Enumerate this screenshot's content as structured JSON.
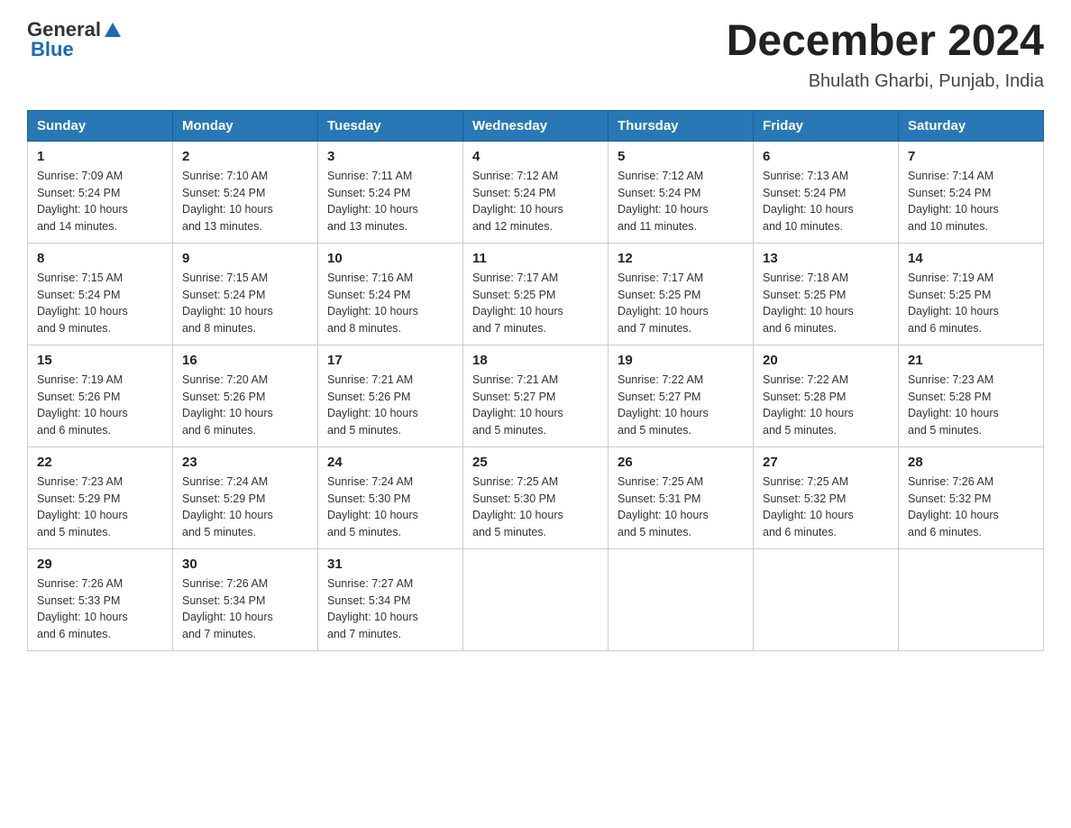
{
  "header": {
    "logo_general": "General",
    "logo_blue": "Blue",
    "title": "December 2024",
    "subtitle": "Bhulath Gharbi, Punjab, India"
  },
  "weekdays": [
    "Sunday",
    "Monday",
    "Tuesday",
    "Wednesday",
    "Thursday",
    "Friday",
    "Saturday"
  ],
  "weeks": [
    [
      {
        "day": "1",
        "sunrise": "7:09 AM",
        "sunset": "5:24 PM",
        "daylight": "10 hours and 14 minutes."
      },
      {
        "day": "2",
        "sunrise": "7:10 AM",
        "sunset": "5:24 PM",
        "daylight": "10 hours and 13 minutes."
      },
      {
        "day": "3",
        "sunrise": "7:11 AM",
        "sunset": "5:24 PM",
        "daylight": "10 hours and 13 minutes."
      },
      {
        "day": "4",
        "sunrise": "7:12 AM",
        "sunset": "5:24 PM",
        "daylight": "10 hours and 12 minutes."
      },
      {
        "day": "5",
        "sunrise": "7:12 AM",
        "sunset": "5:24 PM",
        "daylight": "10 hours and 11 minutes."
      },
      {
        "day": "6",
        "sunrise": "7:13 AM",
        "sunset": "5:24 PM",
        "daylight": "10 hours and 10 minutes."
      },
      {
        "day": "7",
        "sunrise": "7:14 AM",
        "sunset": "5:24 PM",
        "daylight": "10 hours and 10 minutes."
      }
    ],
    [
      {
        "day": "8",
        "sunrise": "7:15 AM",
        "sunset": "5:24 PM",
        "daylight": "10 hours and 9 minutes."
      },
      {
        "day": "9",
        "sunrise": "7:15 AM",
        "sunset": "5:24 PM",
        "daylight": "10 hours and 8 minutes."
      },
      {
        "day": "10",
        "sunrise": "7:16 AM",
        "sunset": "5:24 PM",
        "daylight": "10 hours and 8 minutes."
      },
      {
        "day": "11",
        "sunrise": "7:17 AM",
        "sunset": "5:25 PM",
        "daylight": "10 hours and 7 minutes."
      },
      {
        "day": "12",
        "sunrise": "7:17 AM",
        "sunset": "5:25 PM",
        "daylight": "10 hours and 7 minutes."
      },
      {
        "day": "13",
        "sunrise": "7:18 AM",
        "sunset": "5:25 PM",
        "daylight": "10 hours and 6 minutes."
      },
      {
        "day": "14",
        "sunrise": "7:19 AM",
        "sunset": "5:25 PM",
        "daylight": "10 hours and 6 minutes."
      }
    ],
    [
      {
        "day": "15",
        "sunrise": "7:19 AM",
        "sunset": "5:26 PM",
        "daylight": "10 hours and 6 minutes."
      },
      {
        "day": "16",
        "sunrise": "7:20 AM",
        "sunset": "5:26 PM",
        "daylight": "10 hours and 6 minutes."
      },
      {
        "day": "17",
        "sunrise": "7:21 AM",
        "sunset": "5:26 PM",
        "daylight": "10 hours and 5 minutes."
      },
      {
        "day": "18",
        "sunrise": "7:21 AM",
        "sunset": "5:27 PM",
        "daylight": "10 hours and 5 minutes."
      },
      {
        "day": "19",
        "sunrise": "7:22 AM",
        "sunset": "5:27 PM",
        "daylight": "10 hours and 5 minutes."
      },
      {
        "day": "20",
        "sunrise": "7:22 AM",
        "sunset": "5:28 PM",
        "daylight": "10 hours and 5 minutes."
      },
      {
        "day": "21",
        "sunrise": "7:23 AM",
        "sunset": "5:28 PM",
        "daylight": "10 hours and 5 minutes."
      }
    ],
    [
      {
        "day": "22",
        "sunrise": "7:23 AM",
        "sunset": "5:29 PM",
        "daylight": "10 hours and 5 minutes."
      },
      {
        "day": "23",
        "sunrise": "7:24 AM",
        "sunset": "5:29 PM",
        "daylight": "10 hours and 5 minutes."
      },
      {
        "day": "24",
        "sunrise": "7:24 AM",
        "sunset": "5:30 PM",
        "daylight": "10 hours and 5 minutes."
      },
      {
        "day": "25",
        "sunrise": "7:25 AM",
        "sunset": "5:30 PM",
        "daylight": "10 hours and 5 minutes."
      },
      {
        "day": "26",
        "sunrise": "7:25 AM",
        "sunset": "5:31 PM",
        "daylight": "10 hours and 5 minutes."
      },
      {
        "day": "27",
        "sunrise": "7:25 AM",
        "sunset": "5:32 PM",
        "daylight": "10 hours and 6 minutes."
      },
      {
        "day": "28",
        "sunrise": "7:26 AM",
        "sunset": "5:32 PM",
        "daylight": "10 hours and 6 minutes."
      }
    ],
    [
      {
        "day": "29",
        "sunrise": "7:26 AM",
        "sunset": "5:33 PM",
        "daylight": "10 hours and 6 minutes."
      },
      {
        "day": "30",
        "sunrise": "7:26 AM",
        "sunset": "5:34 PM",
        "daylight": "10 hours and 7 minutes."
      },
      {
        "day": "31",
        "sunrise": "7:27 AM",
        "sunset": "5:34 PM",
        "daylight": "10 hours and 7 minutes."
      },
      null,
      null,
      null,
      null
    ]
  ],
  "labels": {
    "sunrise": "Sunrise:",
    "sunset": "Sunset:",
    "daylight": "Daylight:"
  }
}
